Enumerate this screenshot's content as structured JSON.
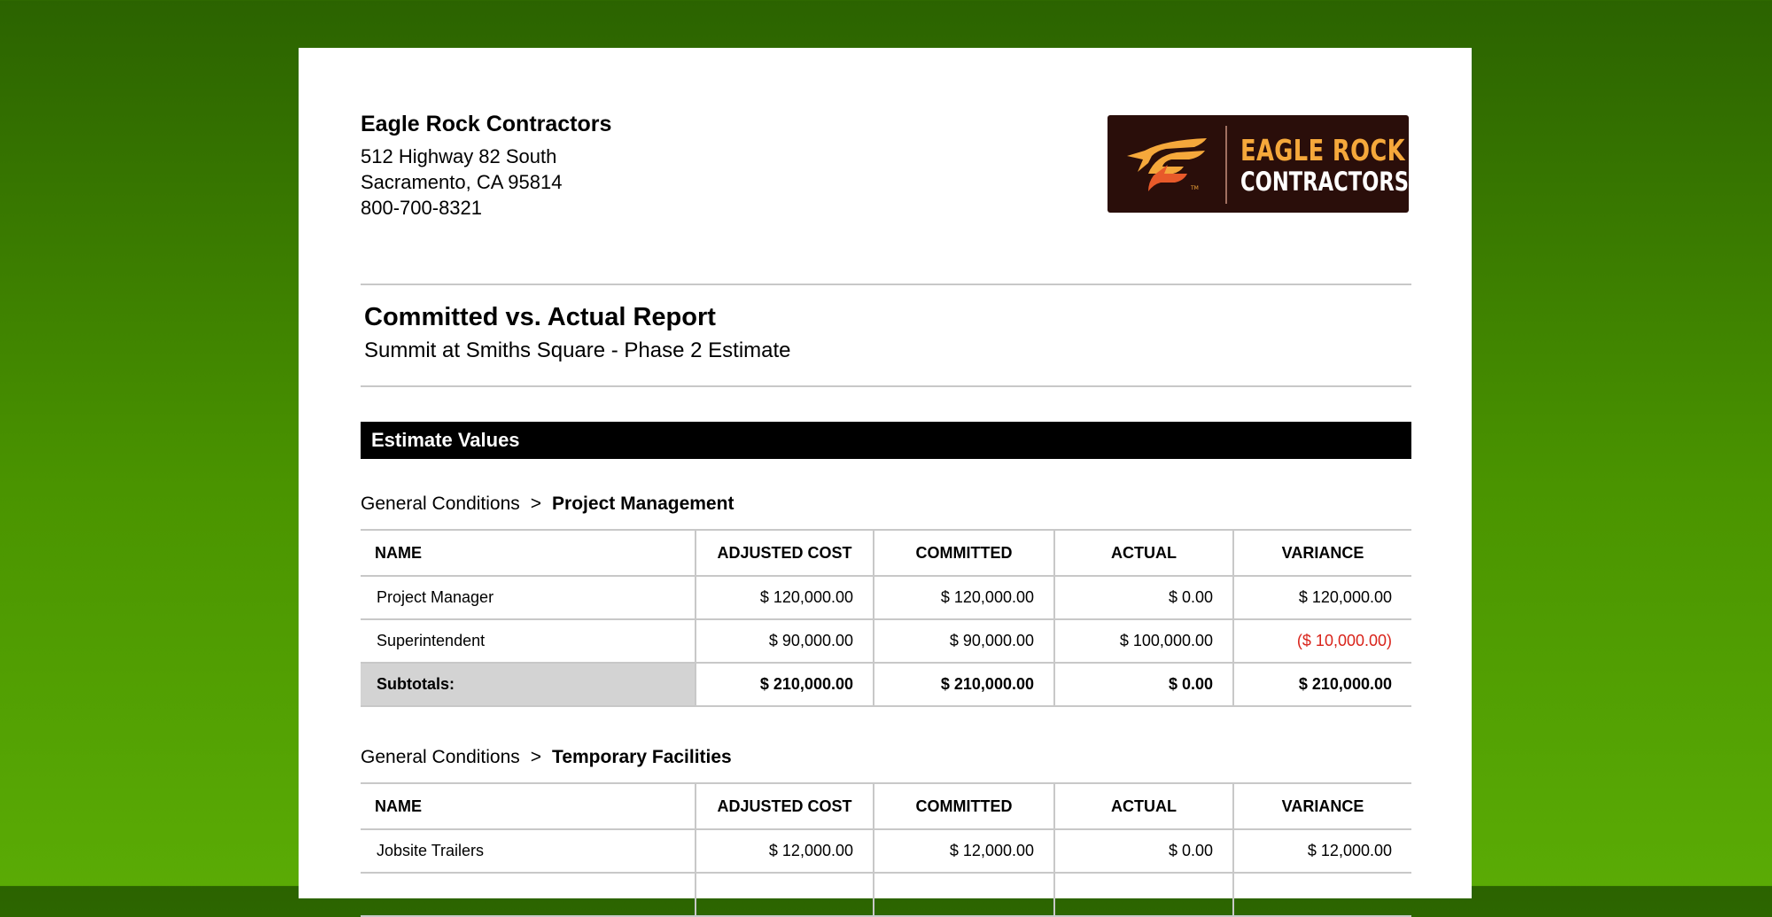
{
  "company": {
    "name": "Eagle Rock Contractors",
    "address_lines": [
      "512 Highway 82 South",
      "Sacramento, CA 95814",
      "800-700-8321"
    ],
    "logo": {
      "line1": "EAGLE ROCK",
      "line2": "CONTRACTORS",
      "mark": "eagle-logo-icon",
      "tm": "TM"
    }
  },
  "report": {
    "title": "Committed vs. Actual Report",
    "subtitle": "Summit at Smiths Square - Phase 2 Estimate"
  },
  "section": {
    "title": "Estimate Values"
  },
  "columns": [
    "NAME",
    "ADJUSTED COST",
    "COMMITTED",
    "ACTUAL",
    "VARIANCE"
  ],
  "groups": [
    {
      "parent": "General Conditions",
      "separator": ">",
      "child": "Project Management",
      "rows": [
        [
          "Project Manager",
          "$ 120,000.00",
          "$ 120,000.00",
          "$ 0.00",
          "$ 120,000.00"
        ],
        [
          "Superintendent",
          "$ 90,000.00",
          "$ 90,000.00",
          "$ 100,000.00",
          "($ 10,000.00)"
        ]
      ],
      "subtotal": [
        "Subtotals:",
        "$ 210,000.00",
        "$ 210,000.00",
        "$ 0.00",
        "$ 210,000.00"
      ]
    },
    {
      "parent": "General Conditions",
      "separator": ">",
      "child": "Temporary Facilities",
      "rows": [
        [
          "Jobsite Trailers",
          "$ 12,000.00",
          "$ 12,000.00",
          "$ 0.00",
          "$ 12,000.00"
        ]
      ]
    }
  ],
  "colors": {
    "negative": "#d9231a",
    "logo_bg": "#2a0e0a",
    "logo_accent": "#f5a83b",
    "band_bg": "#000000"
  }
}
